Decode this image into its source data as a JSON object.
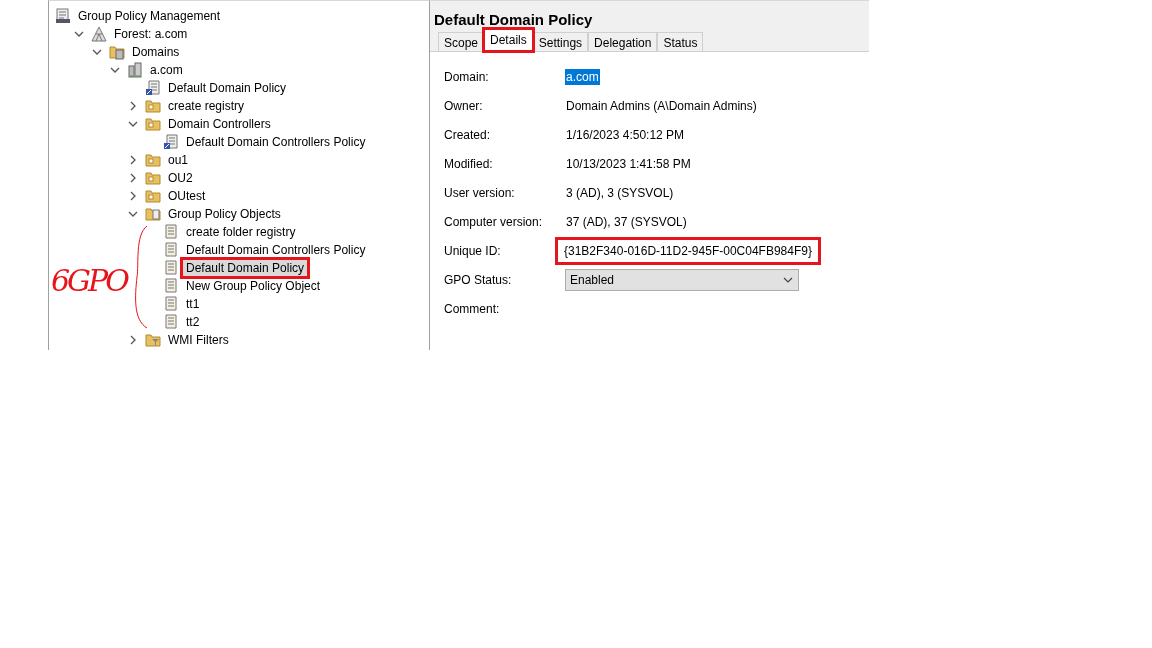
{
  "tree": [
    {
      "label": "Group Policy Management",
      "kind": "console",
      "selected": false,
      "highlighted": false,
      "children": [
        {
          "label": "Forest: a.com",
          "kind": "forest",
          "selected": false,
          "highlighted": false,
          "expanded": true,
          "children": [
            {
              "label": "Domains",
              "kind": "domains",
              "selected": false,
              "highlighted": false,
              "expanded": true,
              "children": [
                {
                  "label": "a.com",
                  "kind": "domain",
                  "selected": false,
                  "highlighted": false,
                  "expanded": true,
                  "children": [
                    {
                      "label": "Default Domain Policy",
                      "kind": "link",
                      "selected": false,
                      "highlighted": false
                    },
                    {
                      "label": "create registry",
                      "kind": "ou",
                      "selected": false,
                      "highlighted": false,
                      "expanded": false
                    },
                    {
                      "label": "Domain Controllers",
                      "kind": "ou",
                      "selected": false,
                      "highlighted": false,
                      "expanded": true,
                      "children": [
                        {
                          "label": "Default Domain Controllers Policy",
                          "kind": "link",
                          "selected": false,
                          "highlighted": false
                        }
                      ]
                    },
                    {
                      "label": "ou1",
                      "kind": "ou",
                      "selected": false,
                      "highlighted": false,
                      "expanded": false
                    },
                    {
                      "label": "OU2",
                      "kind": "ou",
                      "selected": false,
                      "highlighted": false,
                      "expanded": false
                    },
                    {
                      "label": "OUtest",
                      "kind": "ou",
                      "selected": false,
                      "highlighted": false,
                      "expanded": false
                    },
                    {
                      "label": "Group Policy Objects",
                      "kind": "gpofolder",
                      "selected": false,
                      "highlighted": false,
                      "expanded": true,
                      "children": [
                        {
                          "label": "create folder registry",
                          "kind": "gpo",
                          "selected": false,
                          "highlighted": false
                        },
                        {
                          "label": "Default Domain Controllers Policy",
                          "kind": "gpo",
                          "selected": false,
                          "highlighted": false
                        },
                        {
                          "label": "Default Domain Policy",
                          "kind": "gpo",
                          "selected": true,
                          "highlighted": true
                        },
                        {
                          "label": "New Group Policy Object",
                          "kind": "gpo",
                          "selected": false,
                          "highlighted": false
                        },
                        {
                          "label": "tt1",
                          "kind": "gpo",
                          "selected": false,
                          "highlighted": false
                        },
                        {
                          "label": "tt2",
                          "kind": "gpo",
                          "selected": false,
                          "highlighted": false
                        }
                      ]
                    },
                    {
                      "label": "WMI Filters",
                      "kind": "wmi",
                      "selected": false,
                      "highlighted": false,
                      "expanded": false
                    }
                  ]
                }
              ]
            }
          ]
        }
      ]
    }
  ],
  "annotation": {
    "text": "6GPO"
  },
  "details": {
    "title": "Default Domain Policy",
    "tabs": [
      {
        "label": "Scope",
        "selected": false,
        "highlighted": false
      },
      {
        "label": "Details",
        "selected": true,
        "highlighted": true
      },
      {
        "label": "Settings",
        "selected": false,
        "highlighted": false
      },
      {
        "label": "Delegation",
        "selected": false,
        "highlighted": false
      },
      {
        "label": "Status",
        "selected": false,
        "highlighted": false
      }
    ],
    "fields": [
      {
        "label": "Domain:",
        "value": "a.com",
        "kind": "selected-text"
      },
      {
        "label": "Owner:",
        "value": "Domain Admins (A\\Domain Admins)",
        "kind": "text"
      },
      {
        "label": "Created:",
        "value": "1/16/2023 4:50:12 PM",
        "kind": "text"
      },
      {
        "label": "Modified:",
        "value": "10/13/2023 1:41:58 PM",
        "kind": "text"
      },
      {
        "label": "User version:",
        "value": "3 (AD), 3 (SYSVOL)",
        "kind": "text"
      },
      {
        "label": "Computer version:",
        "value": "37 (AD), 37 (SYSVOL)",
        "kind": "text"
      },
      {
        "label": "Unique ID:",
        "value": "{31B2F340-016D-11D2-945F-00C04FB984F9}",
        "kind": "text",
        "highlighted": true
      },
      {
        "label": "GPO Status:",
        "value": "Enabled",
        "kind": "dropdown"
      },
      {
        "label": "Comment:",
        "kind": "empty"
      }
    ]
  }
}
